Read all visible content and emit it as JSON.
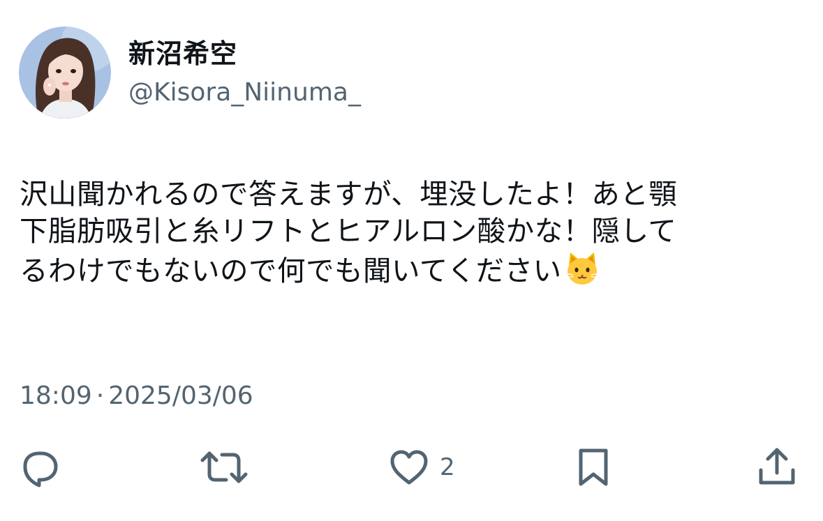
{
  "user": {
    "display_name": "新沼希空",
    "handle": "@Kisora_Niinuma_"
  },
  "post": {
    "lines": [
      "沢山聞かれるので答えますが、埋没したよ！あと顎",
      "下脂肪吸引と糸リフトとヒアルロン酸かな！隠して",
      "るわけでもないので何でも聞いてください"
    ],
    "emoji": "cat-face"
  },
  "meta": {
    "time": "18:09",
    "separator": "·",
    "date": "2025/03/06"
  },
  "actions": {
    "reply_icon": "reply-icon",
    "repost_icon": "repost-icon",
    "like_icon": "like-icon",
    "like_count": "2",
    "bookmark_icon": "bookmark-icon",
    "share_icon": "share-icon"
  },
  "colors": {
    "text": "#0f1419",
    "secondary": "#536471",
    "icon": "#536471"
  }
}
